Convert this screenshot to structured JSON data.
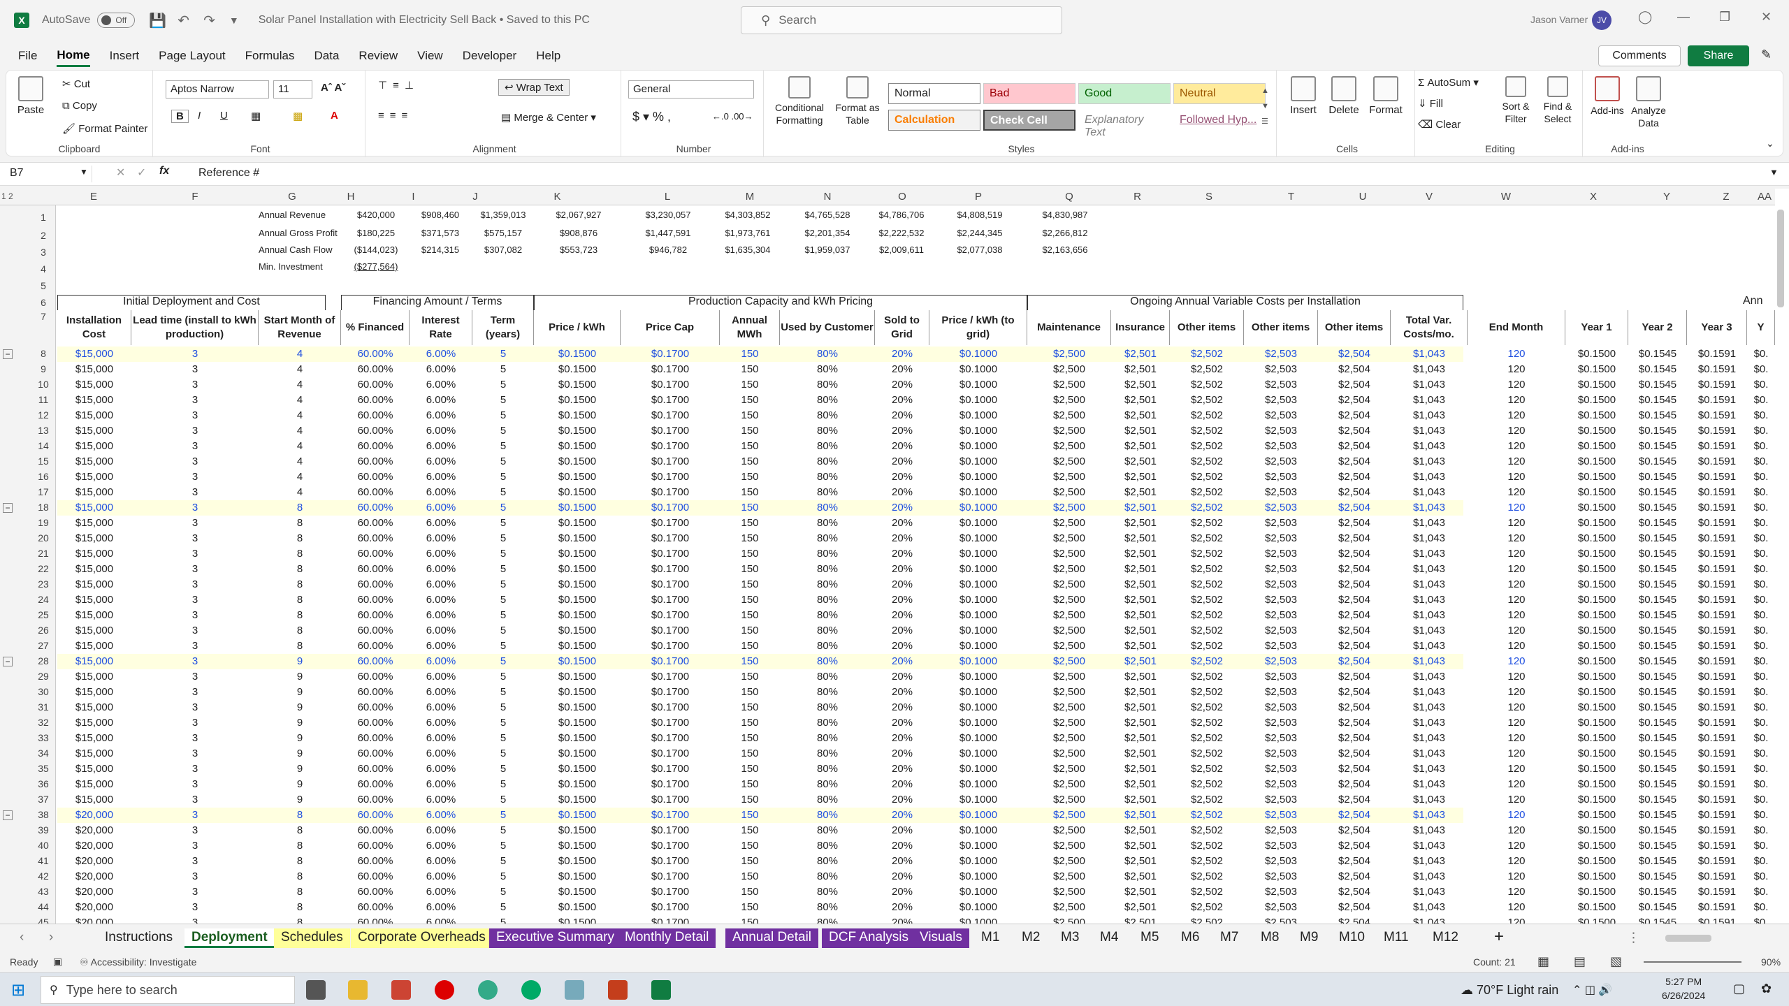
{
  "app": {
    "autosave_label": "AutoSave",
    "autosave_state": "Off",
    "doc_title": "Solar Panel Installation with Electricity Sell Back • Saved to this PC",
    "search_placeholder": "Search",
    "user_name": "Jason Varner",
    "user_initials": "JV"
  },
  "menu": [
    "File",
    "Home",
    "Insert",
    "Page Layout",
    "Formulas",
    "Data",
    "Review",
    "View",
    "Developer",
    "Help"
  ],
  "menu_active": "Home",
  "ribbon": {
    "comments": "Comments",
    "share": "Share",
    "clipboard": {
      "paste": "Paste",
      "cut": "Cut",
      "copy": "Copy",
      "format_painter": "Format Painter",
      "label": "Clipboard"
    },
    "font": {
      "name": "Aptos Narrow",
      "size": "11",
      "label": "Font"
    },
    "alignment": {
      "wrap": "Wrap Text",
      "merge": "Merge & Center",
      "label": "Alignment"
    },
    "number": {
      "format": "General",
      "label": "Number"
    },
    "styles": {
      "cond": "Conditional Formatting",
      "table": "Format as Table",
      "normal": "Normal",
      "bad": "Bad",
      "good": "Good",
      "neutral": "Neutral",
      "calculation": "Calculation",
      "check": "Check Cell",
      "explanatory": "Explanatory Text",
      "followed": "Followed Hyp...",
      "label": "Styles"
    },
    "cells": {
      "insert": "Insert",
      "delete": "Delete",
      "format": "Format",
      "label": "Cells"
    },
    "editing": {
      "autosum": "AutoSum",
      "fill": "Fill",
      "clear": "Clear",
      "sort": "Sort & Filter",
      "find": "Find & Select",
      "label": "Editing"
    },
    "addins": {
      "addins": "Add-ins",
      "analyze": "Analyze Data",
      "label": "Add-ins"
    }
  },
  "formula_bar": {
    "namebox": "B7",
    "formula": "Reference #"
  },
  "columns": [
    "E",
    "F",
    "G",
    "H",
    "I",
    "J",
    "K",
    "L",
    "M",
    "N",
    "O",
    "P",
    "Q",
    "R",
    "S",
    "T",
    "U",
    "V",
    "W",
    "X",
    "Y",
    "Z",
    "AA"
  ],
  "summary": {
    "labels": [
      "Annual Revenue",
      "Annual Gross Profit",
      "Annual Cash Flow",
      "Min. Investment"
    ],
    "rows": [
      [
        "$420,000",
        "$908,460",
        "$1,359,013",
        "$2,067,927",
        "$3,230,057",
        "$4,303,852",
        "$4,765,528",
        "$4,786,706",
        "$4,808,519",
        "$4,830,987"
      ],
      [
        "$180,225",
        "$371,573",
        "$575,157",
        "$908,876",
        "$1,447,591",
        "$1,973,761",
        "$2,201,354",
        "$2,222,532",
        "$2,244,345",
        "$2,266,812"
      ],
      [
        "($144,023)",
        "$214,315",
        "$307,082",
        "$553,723",
        "$946,782",
        "$1,635,304",
        "$1,959,037",
        "$2,009,611",
        "$2,077,038",
        "$2,163,656"
      ],
      [
        "($277,564)"
      ]
    ]
  },
  "section_headers": {
    "initial": "Initial Deployment and Cost",
    "financing": "Financing Amount / Terms",
    "production": "Production Capacity and kWh Pricing",
    "ongoing": "Ongoing Annual Variable Costs per Installation",
    "annual": "Ann"
  },
  "col_headers": [
    "Installation Cost",
    "Lead time (install to kWh production)",
    "Start Month of Revenue",
    "% Financed",
    "Interest Rate",
    "Term (years)",
    "Price / kWh",
    "Price Cap",
    "Annual MWh",
    "Used by Customer",
    "Sold to Grid",
    "Price / kWh (to grid)",
    "Maintenance",
    "Insurance",
    "Other items",
    "Other items",
    "Other items",
    "Total Var. Costs/mo.",
    "End Month",
    "Year 1",
    "Year 2",
    "Year 3",
    "Y"
  ],
  "rows": [
    {
      "n": "8",
      "cost": "$15,000",
      "start": "4",
      "hl": true
    },
    {
      "n": "9",
      "cost": "$15,000",
      "start": "4"
    },
    {
      "n": "10",
      "cost": "$15,000",
      "start": "4"
    },
    {
      "n": "11",
      "cost": "$15,000",
      "start": "4"
    },
    {
      "n": "12",
      "cost": "$15,000",
      "start": "4"
    },
    {
      "n": "13",
      "cost": "$15,000",
      "start": "4"
    },
    {
      "n": "14",
      "cost": "$15,000",
      "start": "4"
    },
    {
      "n": "15",
      "cost": "$15,000",
      "start": "4"
    },
    {
      "n": "16",
      "cost": "$15,000",
      "start": "4"
    },
    {
      "n": "17",
      "cost": "$15,000",
      "start": "4"
    },
    {
      "n": "18",
      "cost": "$15,000",
      "start": "8",
      "hl": true
    },
    {
      "n": "19",
      "cost": "$15,000",
      "start": "8"
    },
    {
      "n": "20",
      "cost": "$15,000",
      "start": "8"
    },
    {
      "n": "21",
      "cost": "$15,000",
      "start": "8"
    },
    {
      "n": "22",
      "cost": "$15,000",
      "start": "8"
    },
    {
      "n": "23",
      "cost": "$15,000",
      "start": "8"
    },
    {
      "n": "24",
      "cost": "$15,000",
      "start": "8"
    },
    {
      "n": "25",
      "cost": "$15,000",
      "start": "8"
    },
    {
      "n": "26",
      "cost": "$15,000",
      "start": "8"
    },
    {
      "n": "27",
      "cost": "$15,000",
      "start": "8"
    },
    {
      "n": "28",
      "cost": "$15,000",
      "start": "9",
      "hl": true
    },
    {
      "n": "29",
      "cost": "$15,000",
      "start": "9"
    },
    {
      "n": "30",
      "cost": "$15,000",
      "start": "9"
    },
    {
      "n": "31",
      "cost": "$15,000",
      "start": "9"
    },
    {
      "n": "32",
      "cost": "$15,000",
      "start": "9"
    },
    {
      "n": "33",
      "cost": "$15,000",
      "start": "9"
    },
    {
      "n": "34",
      "cost": "$15,000",
      "start": "9"
    },
    {
      "n": "35",
      "cost": "$15,000",
      "start": "9"
    },
    {
      "n": "36",
      "cost": "$15,000",
      "start": "9"
    },
    {
      "n": "37",
      "cost": "$15,000",
      "start": "9"
    },
    {
      "n": "38",
      "cost": "$20,000",
      "start": "8",
      "hl": true
    },
    {
      "n": "39",
      "cost": "$20,000",
      "start": "8"
    },
    {
      "n": "40",
      "cost": "$20,000",
      "start": "8"
    },
    {
      "n": "41",
      "cost": "$20,000",
      "start": "8"
    },
    {
      "n": "42",
      "cost": "$20,000",
      "start": "8"
    },
    {
      "n": "43",
      "cost": "$20,000",
      "start": "8"
    },
    {
      "n": "44",
      "cost": "$20,000",
      "start": "8"
    },
    {
      "n": "45",
      "cost": "$20,000",
      "start": "8"
    }
  ],
  "row_constants": {
    "lead": "3",
    "fin": "60.00%",
    "rate": "6.00%",
    "term": "5",
    "price": "$0.1500",
    "cap": "$0.1700",
    "mwh": "150",
    "used": "80%",
    "sold": "20%",
    "grid": "$0.1000",
    "maint": "$2,500",
    "ins": "$2,501",
    "o1": "$2,502",
    "o2": "$2,503",
    "o3": "$2,504",
    "total": "$1,043",
    "end": "120",
    "y1": "$0.1500",
    "y2": "$0.1545",
    "y3": "$0.1591",
    "y4": "$0."
  },
  "sheets": [
    {
      "name": "Instructions",
      "style": "plain"
    },
    {
      "name": "Deployment",
      "style": "active"
    },
    {
      "name": "Schedules",
      "style": "yellow"
    },
    {
      "name": "Corporate Overheads",
      "style": "yellow"
    },
    {
      "name": "Executive Summary",
      "style": "purple"
    },
    {
      "name": "Monthly Detail",
      "style": "purple"
    },
    {
      "name": "Annual Detail",
      "style": "purple"
    },
    {
      "name": "DCF Analysis",
      "style": "purple"
    },
    {
      "name": "Visuals",
      "style": "purple"
    },
    {
      "name": "M1",
      "style": "plain"
    },
    {
      "name": "M2",
      "style": "plain"
    },
    {
      "name": "M3",
      "style": "plain"
    },
    {
      "name": "M4",
      "style": "plain"
    },
    {
      "name": "M5",
      "style": "plain"
    },
    {
      "name": "M6",
      "style": "plain"
    },
    {
      "name": "M7",
      "style": "plain"
    },
    {
      "name": "M8",
      "style": "plain"
    },
    {
      "name": "M9",
      "style": "plain"
    },
    {
      "name": "M10",
      "style": "plain"
    },
    {
      "name": "M11",
      "style": "plain"
    },
    {
      "name": "M12",
      "style": "plain"
    }
  ],
  "status": {
    "ready": "Ready",
    "accessibility": "Accessibility: Investigate",
    "count": "Count: 21",
    "zoom": "90%"
  },
  "taskbar": {
    "search": "Type here to search",
    "weather": "70°F  Light rain",
    "time": "5:27 PM",
    "date": "6/26/2024"
  }
}
